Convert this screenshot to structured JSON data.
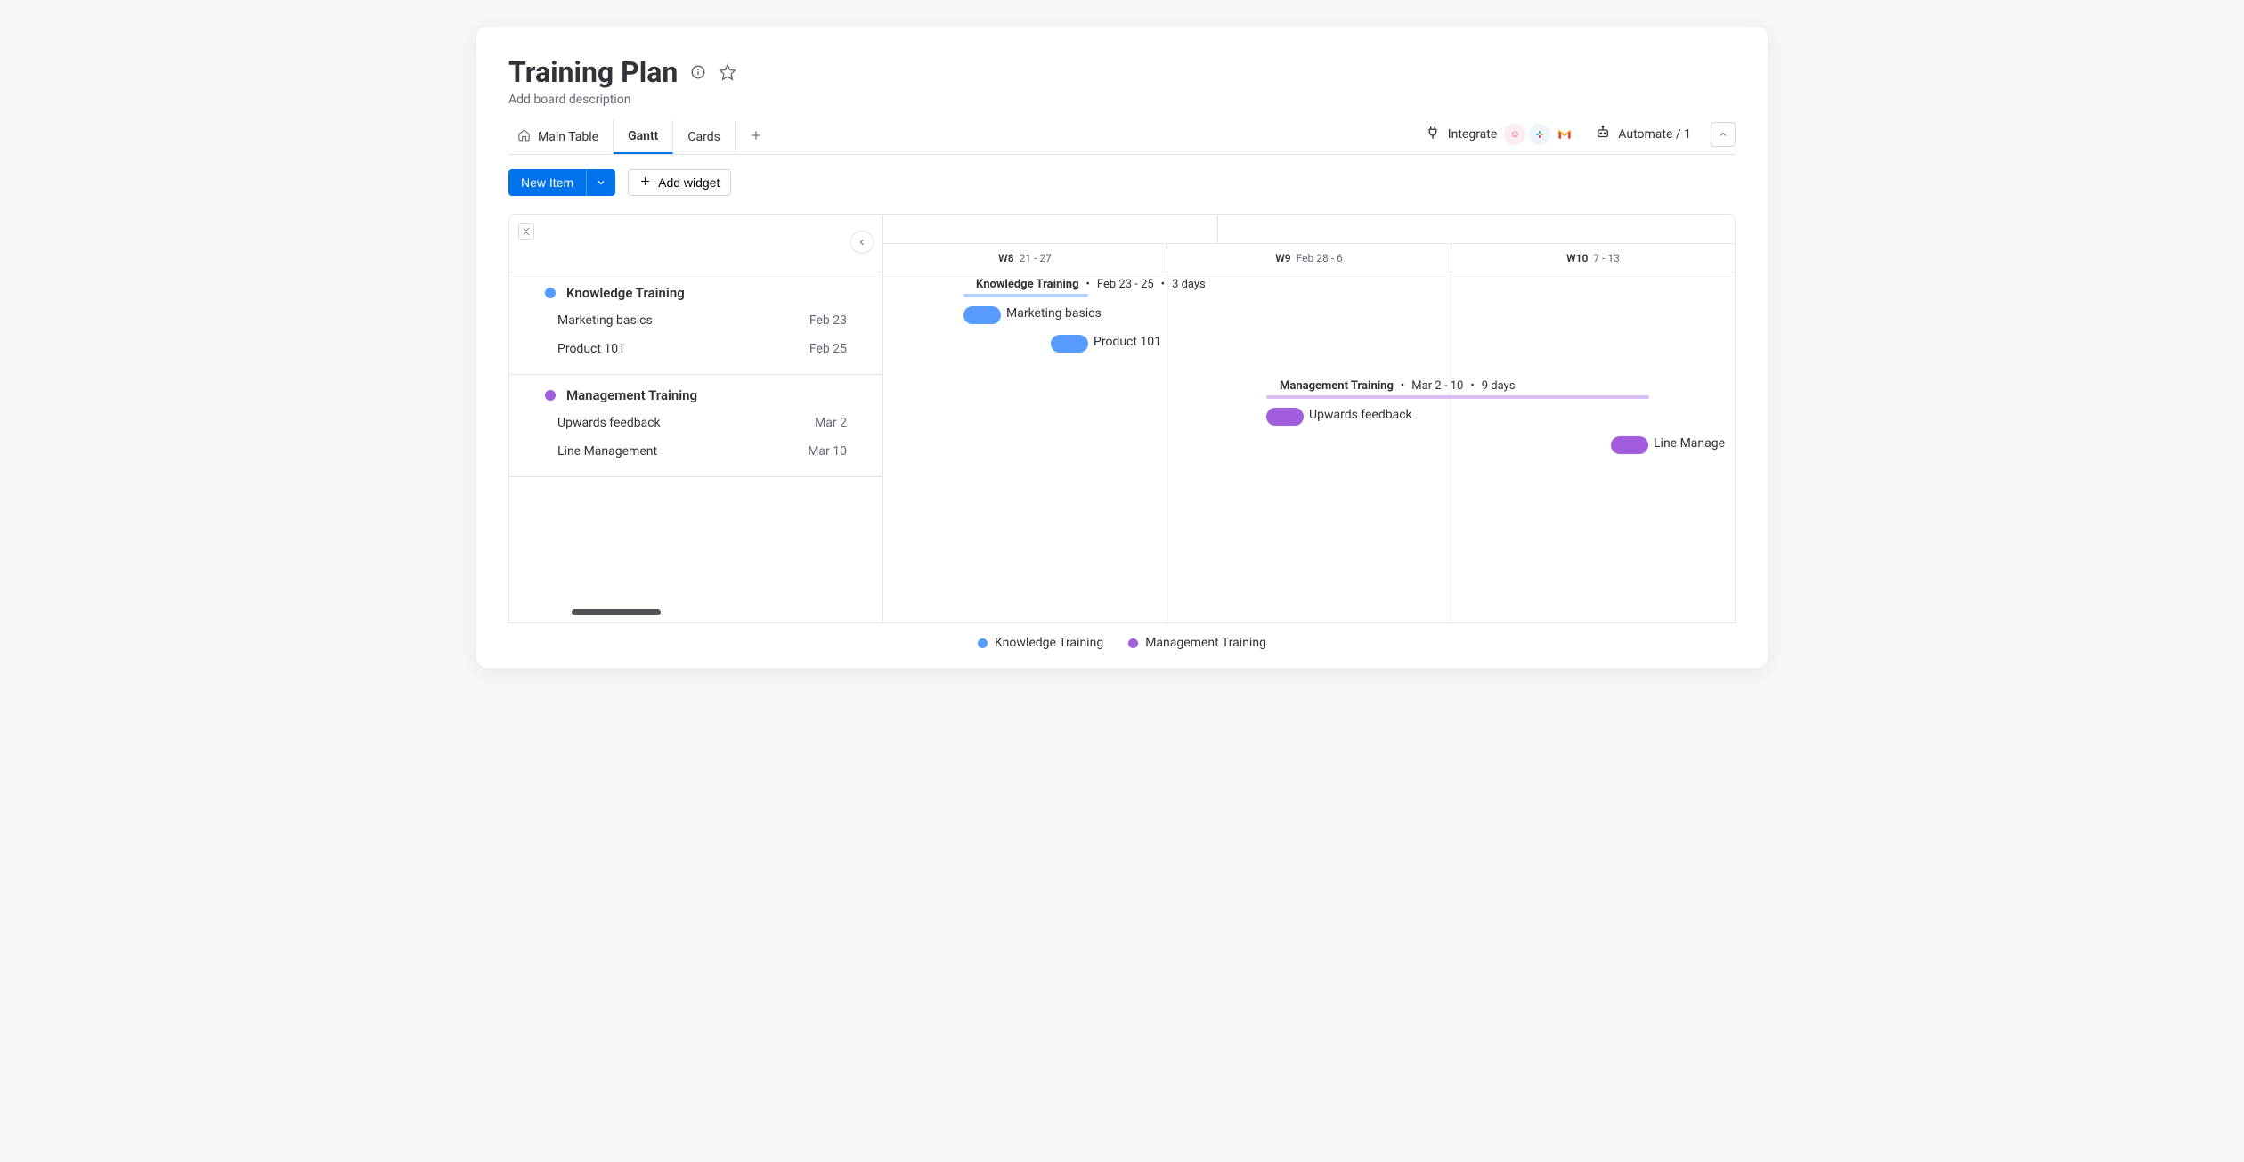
{
  "header": {
    "title": "Training Plan",
    "description": "Add board description"
  },
  "tabs": {
    "main_table": "Main Table",
    "gantt": "Gantt",
    "cards": "Cards"
  },
  "tools": {
    "integrate": "Integrate",
    "automate": "Automate / 1"
  },
  "actions": {
    "new_item": "New Item",
    "add_widget": "Add widget"
  },
  "timeline": {
    "weeks": [
      {
        "wn": "W8",
        "range": "21 - 27"
      },
      {
        "wn": "W9",
        "range": "Feb 28 - 6"
      },
      {
        "wn": "W10",
        "range": "7 - 13"
      }
    ]
  },
  "groups": [
    {
      "name": "Knowledge Training",
      "color": "blue",
      "summary_name": "Knowledge Training",
      "summary_range": "Feb 23 - 25",
      "summary_duration": "3 days",
      "items": [
        {
          "name": "Marketing basics",
          "date": "Feb 23"
        },
        {
          "name": "Product 101",
          "date": "Feb 25"
        }
      ]
    },
    {
      "name": "Management Training",
      "color": "purple",
      "summary_name": "Management Training",
      "summary_range": "Mar 2 - 10",
      "summary_duration": "9 days",
      "items": [
        {
          "name": "Upwards feedback",
          "date": "Mar 2"
        },
        {
          "name": "Line Management",
          "date": "Mar 10"
        }
      ]
    }
  ],
  "legend": {
    "a": "Knowledge Training",
    "b": "Management Training"
  },
  "chart_data": {
    "type": "gantt",
    "time_axis": {
      "unit": "week",
      "labels": [
        "W8 21-27",
        "W9 Feb 28-6",
        "W10 7-13"
      ]
    },
    "series": [
      {
        "group": "Knowledge Training",
        "color": "#579bfc",
        "summary": {
          "start": "Feb 23",
          "end": "Feb 25",
          "duration_days": 3
        },
        "tasks": [
          {
            "name": "Marketing basics",
            "start": "Feb 23",
            "duration_days": 1
          },
          {
            "name": "Product 101",
            "start": "Feb 25",
            "duration_days": 1
          }
        ]
      },
      {
        "group": "Management Training",
        "color": "#a25ddc",
        "summary": {
          "start": "Mar 2",
          "end": "Mar 10",
          "duration_days": 9
        },
        "tasks": [
          {
            "name": "Upwards feedback",
            "start": "Mar 2",
            "duration_days": 1
          },
          {
            "name": "Line Management",
            "start": "Mar 10",
            "duration_days": 1
          }
        ]
      }
    ]
  }
}
